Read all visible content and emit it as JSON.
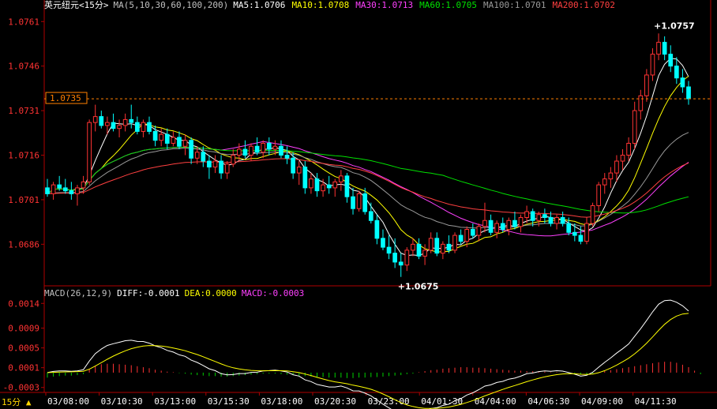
{
  "chart_title": "英元纽元<15分>",
  "ma_settings": "MA(5,10,30,60,100,200)",
  "ma_values": [
    {
      "label": "MA5:1.0706",
      "color": "#ffffff"
    },
    {
      "label": "MA10:1.0708",
      "color": "#ffff00"
    },
    {
      "label": "MA30:1.0713",
      "color": "#ff40ff"
    },
    {
      "label": "MA60:1.0705",
      "color": "#00e000"
    },
    {
      "label": "MA100:1.0701",
      "color": "#9a9a9a"
    },
    {
      "label": "MA200:1.0702",
      "color": "#ff4040"
    }
  ],
  "macd_header": {
    "settings": "MACD(26,12,9)",
    "diff": "DIFF:-0.0001",
    "dea": "DEA:0.0000",
    "macd": "MACD:-0.0003"
  },
  "timeframe_label": "15分",
  "current_price_tag": "1.0735",
  "high_annotation": "1.0757",
  "low_annotation": "1.0675",
  "price_axis_labels": [
    "1.0761",
    "1.0746",
    "1.0731",
    "1.0716",
    "1.0701",
    "1.0686"
  ],
  "macd_axis_labels": [
    "0.0014",
    "0.0009",
    "0.0005",
    "0.0001",
    "-0.0003"
  ],
  "time_axis_labels": [
    "03/08:00",
    "03/10:30",
    "03/13:00",
    "03/15:30",
    "03/18:00",
    "03/20:30",
    "03/23:00",
    "04/01:30",
    "04/04:00",
    "04/06:30",
    "04/09:00",
    "04/11:30"
  ],
  "colors": {
    "up": "#ff3333",
    "down": "#00ffff",
    "axis": "#b00000",
    "grid": "#b00000",
    "price_text": "#ff3333"
  },
  "chart_data": {
    "type": "candlestick",
    "price_ylim": [
      1.0672,
      1.0764
    ],
    "macd_ylim": [
      -0.0004,
      0.0015
    ],
    "ohlc": [
      [
        1.0705,
        1.0708,
        1.0702,
        1.0703
      ],
      [
        1.0703,
        1.0707,
        1.0701,
        1.0706
      ],
      [
        1.0706,
        1.0709,
        1.0704,
        1.0705
      ],
      [
        1.0705,
        1.0708,
        1.0703,
        1.0704
      ],
      [
        1.0704,
        1.0707,
        1.0701,
        1.0703
      ],
      [
        1.0703,
        1.0706,
        1.0699,
        1.0705
      ],
      [
        1.0705,
        1.0709,
        1.0703,
        1.0707
      ],
      [
        1.0707,
        1.0728,
        1.0706,
        1.0727
      ],
      [
        1.0727,
        1.0733,
        1.0724,
        1.0729
      ],
      [
        1.0729,
        1.0731,
        1.0725,
        1.0726
      ],
      [
        1.0726,
        1.0729,
        1.0723,
        1.0727
      ],
      [
        1.0727,
        1.073,
        1.0724,
        1.0725
      ],
      [
        1.0725,
        1.0728,
        1.0722,
        1.0726
      ],
      [
        1.0726,
        1.073,
        1.0724,
        1.0728
      ],
      [
        1.0728,
        1.0733,
        1.0725,
        1.0727
      ],
      [
        1.0727,
        1.0729,
        1.0723,
        1.0724
      ],
      [
        1.0724,
        1.0728,
        1.0722,
        1.0727
      ],
      [
        1.0727,
        1.0729,
        1.0723,
        1.0724
      ],
      [
        1.0724,
        1.0726,
        1.0719,
        1.0721
      ],
      [
        1.0721,
        1.0725,
        1.0719,
        1.0723
      ],
      [
        1.0723,
        1.0725,
        1.0718,
        1.072
      ],
      [
        1.072,
        1.0724,
        1.0719,
        1.0722
      ],
      [
        1.0722,
        1.0724,
        1.0718,
        1.0719
      ],
      [
        1.0719,
        1.0723,
        1.0716,
        1.0721
      ],
      [
        1.0721,
        1.0722,
        1.0713,
        1.0715
      ],
      [
        1.0715,
        1.0719,
        1.0713,
        1.0717
      ],
      [
        1.0717,
        1.0719,
        1.0712,
        1.0714
      ],
      [
        1.0714,
        1.0716,
        1.0708,
        1.0712
      ],
      [
        1.0712,
        1.0716,
        1.071,
        1.0714
      ],
      [
        1.0714,
        1.0716,
        1.0708,
        1.071
      ],
      [
        1.071,
        1.0714,
        1.0708,
        1.0713
      ],
      [
        1.0713,
        1.0718,
        1.0712,
        1.0716
      ],
      [
        1.0716,
        1.072,
        1.0714,
        1.0718
      ],
      [
        1.0718,
        1.0721,
        1.0715,
        1.0716
      ],
      [
        1.0716,
        1.072,
        1.0714,
        1.0719
      ],
      [
        1.0719,
        1.0722,
        1.0716,
        1.0717
      ],
      [
        1.0717,
        1.0721,
        1.0715,
        1.072
      ],
      [
        1.072,
        1.0722,
        1.0716,
        1.0718
      ],
      [
        1.0718,
        1.0721,
        1.0716,
        1.0719
      ],
      [
        1.0719,
        1.0721,
        1.0715,
        1.0716
      ],
      [
        1.0716,
        1.0719,
        1.0713,
        1.0715
      ],
      [
        1.0715,
        1.0717,
        1.0708,
        1.071
      ],
      [
        1.071,
        1.0714,
        1.0706,
        1.0712
      ],
      [
        1.0712,
        1.0714,
        1.0703,
        1.0705
      ],
      [
        1.0705,
        1.071,
        1.0703,
        1.0708
      ],
      [
        1.0708,
        1.071,
        1.0702,
        1.0704
      ],
      [
        1.0704,
        1.0708,
        1.0702,
        1.0706
      ],
      [
        1.0706,
        1.0709,
        1.0703,
        1.0705
      ],
      [
        1.0705,
        1.0708,
        1.0702,
        1.0707
      ],
      [
        1.0707,
        1.0711,
        1.0704,
        1.0709
      ],
      [
        1.0709,
        1.071,
        1.07,
        1.0702
      ],
      [
        1.0702,
        1.0705,
        1.0696,
        1.0698
      ],
      [
        1.0698,
        1.0704,
        1.0697,
        1.0703
      ],
      [
        1.0703,
        1.0705,
        1.0696,
        1.0697
      ],
      [
        1.0697,
        1.07,
        1.0693,
        1.0694
      ],
      [
        1.0694,
        1.0696,
        1.0686,
        1.0688
      ],
      [
        1.0688,
        1.0691,
        1.0684,
        1.0685
      ],
      [
        1.0685,
        1.0689,
        1.0681,
        1.0683
      ],
      [
        1.0683,
        1.0688,
        1.0678,
        1.068
      ],
      [
        1.068,
        1.0683,
        1.0675,
        1.0679
      ],
      [
        1.0679,
        1.0685,
        1.0677,
        1.0684
      ],
      [
        1.0684,
        1.0688,
        1.0682,
        1.0686
      ],
      [
        1.0686,
        1.0688,
        1.0681,
        1.0682
      ],
      [
        1.0682,
        1.0686,
        1.0679,
        1.0684
      ],
      [
        1.0684,
        1.069,
        1.0683,
        1.0688
      ],
      [
        1.0688,
        1.069,
        1.0682,
        1.0683
      ],
      [
        1.0683,
        1.0687,
        1.0681,
        1.0686
      ],
      [
        1.0686,
        1.0689,
        1.0683,
        1.0684
      ],
      [
        1.0684,
        1.069,
        1.0683,
        1.0689
      ],
      [
        1.0689,
        1.0691,
        1.0686,
        1.0687
      ],
      [
        1.0687,
        1.0692,
        1.0685,
        1.0691
      ],
      [
        1.0691,
        1.0693,
        1.0688,
        1.0689
      ],
      [
        1.0689,
        1.0693,
        1.0687,
        1.0692
      ],
      [
        1.0692,
        1.07,
        1.069,
        1.0694
      ],
      [
        1.0694,
        1.0696,
        1.0689,
        1.069
      ],
      [
        1.069,
        1.0694,
        1.0688,
        1.0693
      ],
      [
        1.0693,
        1.0695,
        1.069,
        1.0691
      ],
      [
        1.0691,
        1.0695,
        1.0689,
        1.0694
      ],
      [
        1.0694,
        1.0697,
        1.0691,
        1.0692
      ],
      [
        1.0692,
        1.0696,
        1.069,
        1.0695
      ],
      [
        1.0695,
        1.0699,
        1.0693,
        1.0697
      ],
      [
        1.0697,
        1.0698,
        1.0692,
        1.0694
      ],
      [
        1.0694,
        1.0697,
        1.0692,
        1.0696
      ],
      [
        1.0696,
        1.0698,
        1.0693,
        1.0695
      ],
      [
        1.0695,
        1.0697,
        1.0692,
        1.0693
      ],
      [
        1.0693,
        1.0696,
        1.0691,
        1.0695
      ],
      [
        1.0695,
        1.0697,
        1.0692,
        1.0693
      ],
      [
        1.0693,
        1.0695,
        1.0689,
        1.069
      ],
      [
        1.069,
        1.0693,
        1.0687,
        1.0689
      ],
      [
        1.0689,
        1.0692,
        1.0686,
        1.0687
      ],
      [
        1.0687,
        1.0695,
        1.0686,
        1.0693
      ],
      [
        1.0693,
        1.07,
        1.0692,
        1.0699
      ],
      [
        1.0699,
        1.0707,
        1.0697,
        1.0706
      ],
      [
        1.0706,
        1.071,
        1.0703,
        1.0708
      ],
      [
        1.0708,
        1.0712,
        1.0705,
        1.071
      ],
      [
        1.071,
        1.0716,
        1.0707,
        1.0714
      ],
      [
        1.0714,
        1.0718,
        1.0711,
        1.0716
      ],
      [
        1.0716,
        1.0722,
        1.0714,
        1.072
      ],
      [
        1.072,
        1.0734,
        1.0718,
        1.0731
      ],
      [
        1.0731,
        1.0738,
        1.0728,
        1.0736
      ],
      [
        1.0736,
        1.0745,
        1.0734,
        1.0743
      ],
      [
        1.0743,
        1.0752,
        1.0741,
        1.075
      ],
      [
        1.075,
        1.0757,
        1.0748,
        1.0754
      ],
      [
        1.0754,
        1.0756,
        1.0748,
        1.075
      ],
      [
        1.075,
        1.0753,
        1.0744,
        1.0746
      ],
      [
        1.0746,
        1.0749,
        1.074,
        1.0742
      ],
      [
        1.0742,
        1.0745,
        1.0737,
        1.0739
      ],
      [
        1.0739,
        1.0741,
        1.0733,
        1.0735
      ]
    ],
    "macd_hist": [
      -0.0001,
      -8e-05,
      -7e-05,
      -6e-05,
      -6e-05,
      -5e-05,
      -3e-05,
      8e-05,
      0.00014,
      0.00017,
      0.00018,
      0.00018,
      0.00017,
      0.00016,
      0.00015,
      0.00013,
      0.00011,
      9e-05,
      6e-05,
      4e-05,
      2e-05,
      1e-05,
      -1e-05,
      -2e-05,
      -4e-05,
      -5e-05,
      -6e-05,
      -7e-05,
      -7e-05,
      -8e-05,
      -8e-05,
      -7e-05,
      -6e-05,
      -5e-05,
      -4e-05,
      -3e-05,
      -2e-05,
      -2e-05,
      -2e-05,
      -3e-05,
      -4e-05,
      -5e-05,
      -6e-05,
      -7e-05,
      -8e-05,
      -9e-05,
      -9e-05,
      -0.0001,
      -0.0001,
      -0.0001,
      -0.00011,
      -0.00011,
      -0.0001,
      -0.0001,
      -9e-05,
      -9e-05,
      -8e-05,
      -7e-05,
      -6e-05,
      -5e-05,
      -3e-05,
      -2e-05,
      1e-05,
      3e-05,
      5e-05,
      6e-05,
      8e-05,
      9e-05,
      0.0001,
      0.00011,
      0.00011,
      0.0001,
      0.0001,
      9e-05,
      8e-05,
      7e-05,
      6e-05,
      5e-05,
      4e-05,
      4e-05,
      3e-05,
      3e-05,
      2e-05,
      2e-05,
      1e-05,
      1e-05,
      0.0,
      -1e-05,
      -2e-05,
      -3e-05,
      -3e-05,
      -2e-05,
      1e-05,
      3e-05,
      5e-05,
      7e-05,
      9e-05,
      0.00011,
      0.00013,
      0.00015,
      0.00017,
      0.00019,
      0.00021,
      0.00022,
      0.00022,
      0.0002,
      0.00016,
      0.00011,
      4e-05,
      -3e-05
    ]
  }
}
